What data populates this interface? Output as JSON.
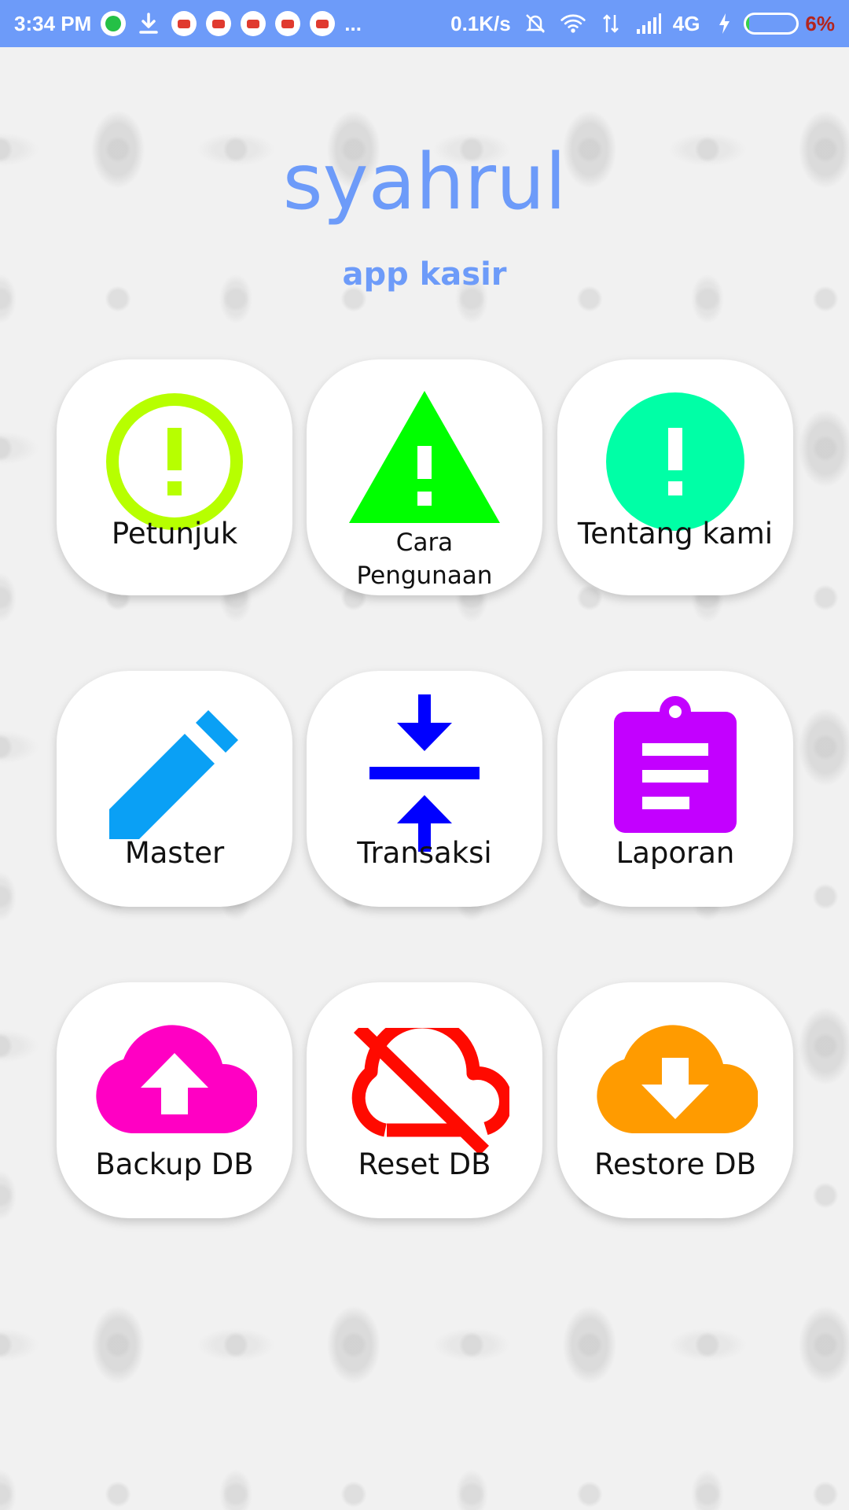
{
  "status_bar": {
    "time": "3:34 PM",
    "more": "...",
    "speed": "0.1K/s",
    "network": "4G",
    "battery_level": 0.06,
    "battery_pct": "6%",
    "icons": [
      "whatsapp-icon",
      "download-icon",
      "youtube-icon",
      "bell-off-icon",
      "wifi-icon",
      "data-arrows-icon",
      "signal-icon",
      "charging-icon",
      "battery-icon"
    ]
  },
  "header": {
    "title": "syahrul",
    "subtitle": "app kasir"
  },
  "menu": {
    "petunjuk": {
      "label": "Petunjuk",
      "icon": "alert-circle-outline-icon",
      "color": "#b7ff00"
    },
    "cara": {
      "label": "Cara Pengunaan",
      "icon": "warning-triangle-icon",
      "color": "#00ff00"
    },
    "tentang": {
      "label": "Tentang kami",
      "icon": "alert-circle-icon",
      "color": "#00ffa6"
    },
    "master": {
      "label": "Master",
      "icon": "pencil-icon",
      "color": "#0aa0f5"
    },
    "transaksi": {
      "label": "Transaksi",
      "icon": "compress-arrows-icon",
      "color": "#0000ff"
    },
    "laporan": {
      "label": "Laporan",
      "icon": "clipboard-icon",
      "color": "#c300ff"
    },
    "backup": {
      "label": "Backup DB",
      "icon": "cloud-upload-icon",
      "color": "#ff00c3"
    },
    "reset": {
      "label": "Reset DB",
      "icon": "cloud-off-icon",
      "color": "#ff0a00"
    },
    "restore": {
      "label": "Restore DB",
      "icon": "cloud-download-icon",
      "color": "#ff9b00"
    }
  },
  "colors": {
    "accent": "#6d9bf9",
    "status_bar": "#6d9bf9",
    "tile_bg": "#ffffff",
    "label_text": "#111111"
  }
}
